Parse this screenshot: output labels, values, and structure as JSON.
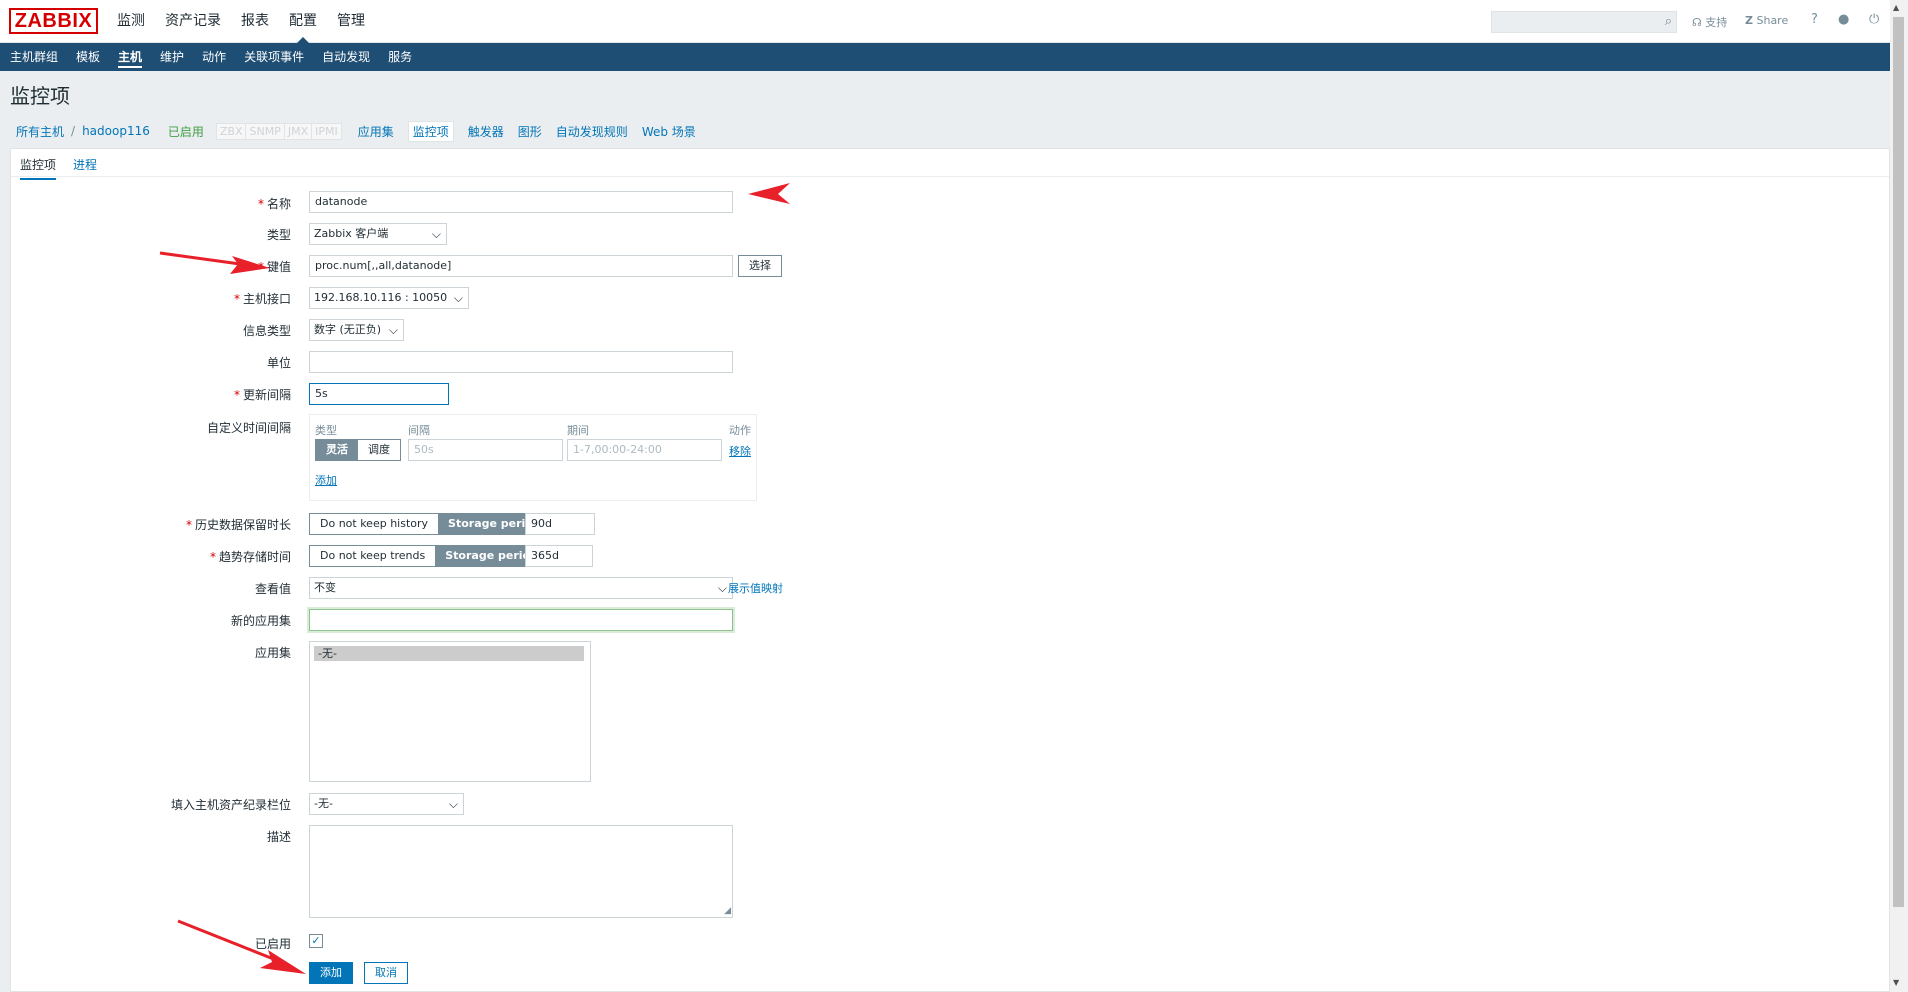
{
  "header": {
    "logo": "ZABBIX",
    "top_nav": [
      "监测",
      "资产记录",
      "报表",
      "配置",
      "管理"
    ],
    "active_top": "配置",
    "support_label": "支持",
    "share_label": "Share",
    "help_icon": "?"
  },
  "sub_nav": [
    "主机群组",
    "模板",
    "主机",
    "维护",
    "动作",
    "关联项事件",
    "自动发现",
    "服务"
  ],
  "active_sub": "主机",
  "page_title": "监控项",
  "breadcrumb": {
    "all_hosts": "所有主机",
    "sep": "/",
    "host": "hadoop116",
    "status": "已启用",
    "availability": [
      "ZBX",
      "SNMP",
      "JMX",
      "IPMI"
    ],
    "links": [
      "应用集",
      "监控项",
      "触发器",
      "图形",
      "自动发现规则",
      "Web 场景"
    ],
    "active_link": "监控项"
  },
  "tabs": [
    "监控项",
    "进程"
  ],
  "form": {
    "name_label": "名称",
    "name_value": "datanode",
    "type_label": "类型",
    "type_value": "Zabbix 客户端",
    "key_label": "键值",
    "key_value": "proc.num[,,all,datanode]",
    "select_button": "选择",
    "interface_label": "主机接口",
    "interface_value": "192.168.10.116 : 10050",
    "info_type_label": "信息类型",
    "info_type_value": "数字 (无正负)",
    "units_label": "单位",
    "units_value": "",
    "interval_label": "更新间隔",
    "interval_value": "5s",
    "custom_label": "自定义时间间隔",
    "custom": {
      "col_type": "类型",
      "col_interval": "间隔",
      "col_period": "期间",
      "col_action": "动作",
      "flex_label": "灵活",
      "sched_label": "调度",
      "interval_placeholder": "50s",
      "period_placeholder": "1-7,00:00-24:00",
      "remove_link": "移除",
      "add_link": "添加"
    },
    "history_label": "历史数据保留时长",
    "history_off": "Do not keep history",
    "history_on": "Storage period",
    "history_value": "90d",
    "trends_label": "趋势存储时间",
    "trends_off": "Do not keep trends",
    "trends_on": "Storage period",
    "trends_value": "365d",
    "valuemap_label": "查看值",
    "valuemap_value": "不变",
    "valuemap_link": "展示值映射",
    "new_app_label": "新的应用集",
    "new_app_value": "",
    "apps_label": "应用集",
    "apps_option": "-无-",
    "inventory_label": "填入主机资产纪录栏位",
    "inventory_value": "-无-",
    "desc_label": "描述",
    "enabled_label": "已启用",
    "add_button": "添加",
    "cancel_button": "取消"
  },
  "colors": {
    "brand_red": "#d40000",
    "nav_blue": "#1f4e74",
    "link_blue": "#0275b8",
    "annotation_red": "#e8202a"
  }
}
